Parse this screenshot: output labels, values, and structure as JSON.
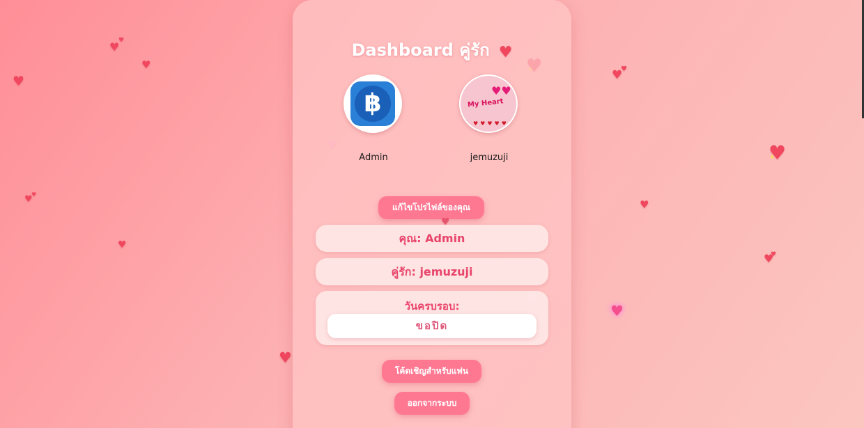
{
  "dashboard": {
    "title": "Dashboard คู่รัก",
    "title_icon": "heart-icon"
  },
  "users": [
    {
      "name": "Admin",
      "avatar": "baht-icon"
    },
    {
      "name": "jemuzuji",
      "avatar": "my-heart-image"
    }
  ],
  "avatar_image_text": "My Heart",
  "buttons": {
    "edit_profile": "แก้ไขโปรไฟล์ของคุณ",
    "invite_code": "โค้ดเชิญสำหรับแฟน",
    "logout": "ออกจากระบบ"
  },
  "info": {
    "you": "คุณ: Admin",
    "partner": "คู่รัก: jemuzuji",
    "anniversary_label": "วันครบรอบ:",
    "anniversary_value": "ขอปิด"
  },
  "colors": {
    "accent": "#ff7892",
    "text_accent": "#e8456a",
    "background_start": "#ff8e97",
    "background_end": "#fcc6c0"
  }
}
